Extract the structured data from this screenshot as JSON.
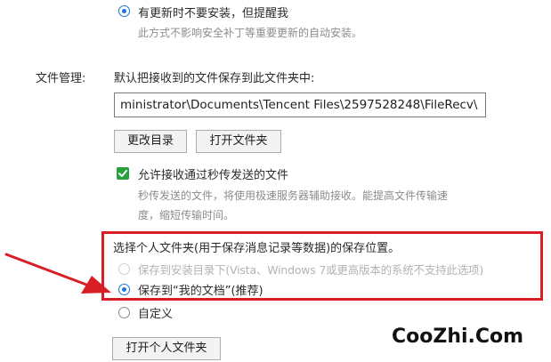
{
  "update_option": {
    "label": "有更新时不要安装，但提醒我",
    "description": "此方式不影响安全补丁等重要更新的自动安装。",
    "checked": true
  },
  "file_management": {
    "section_label": "文件管理:",
    "save_prompt": "默认把接收到的文件保存到此文件夹中:",
    "path_value": "ministrator\\Documents\\Tencent Files\\2597528248\\FileRecv\\",
    "change_dir_button": "更改目录",
    "open_folder_button": "打开文件夹",
    "allow_flash_transfer": {
      "label": "允许接收通过秒传发送的文件",
      "checked": true,
      "description_line1": "秒传发送的文件，将使用极速服务器辅助接收。能提高文件传输速",
      "description_line2": "度，缩短传输时间。"
    }
  },
  "personal_folder": {
    "heading": "选择个人文件夹(用于保存消息记录等数据)的保存位置。",
    "options": [
      {
        "label": "保存到安装目录下(Vista、Windows 7或更高版本的系统不支持此选项)",
        "state": "disabled"
      },
      {
        "label": "保存到“我的文档”(推荐)",
        "state": "checked"
      },
      {
        "label": "自定义",
        "state": "unchecked"
      }
    ],
    "open_personal_folder_button": "打开个人文件夹"
  },
  "colors": {
    "accent": "#1b78d4",
    "checkbox_green": "#27a03e",
    "highlight_red": "#d91f26"
  },
  "watermark": "CooZhi.Com"
}
